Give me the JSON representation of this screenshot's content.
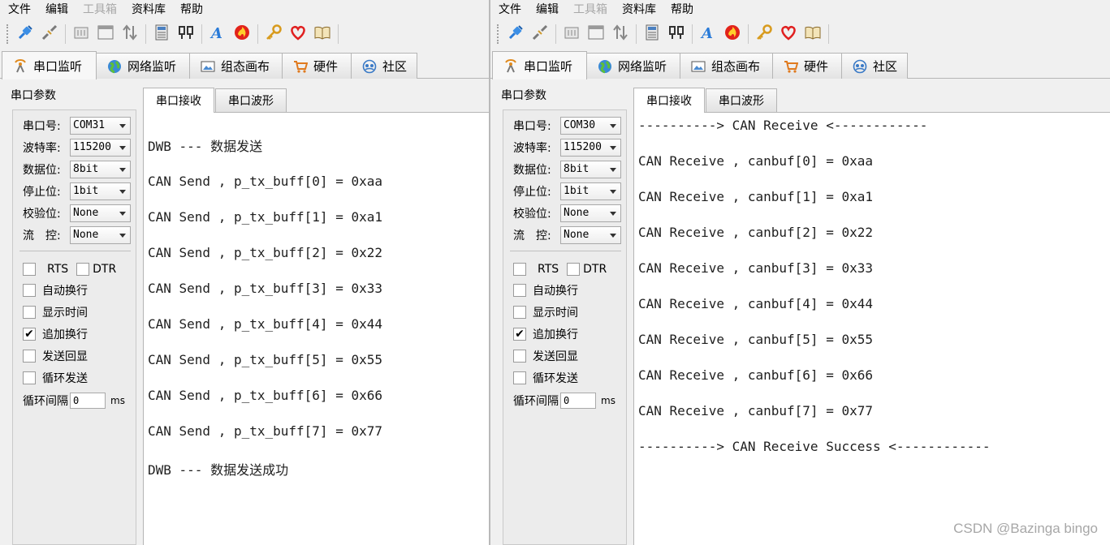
{
  "colors": {
    "accent": "#2a7bd8",
    "window_bg": "#f0f0f0",
    "text": "#1e1e1e",
    "watermark": "#a7a7a7"
  },
  "windows": [
    {
      "menu": [
        "文件",
        "编辑",
        "工具箱",
        "资料库",
        "帮助"
      ],
      "menu_disabled_index": 2,
      "main_tabs": [
        {
          "label": "串口监听",
          "icon": "antenna-icon",
          "active": true
        },
        {
          "label": "网络监听",
          "icon": "globe-icon",
          "active": false
        },
        {
          "label": "组态画布",
          "icon": "canvas-icon",
          "active": false
        },
        {
          "label": "硬件",
          "icon": "cart-icon",
          "active": false
        },
        {
          "label": "社区",
          "icon": "community-icon",
          "active": false
        }
      ],
      "panel_title": "串口参数",
      "settings": [
        {
          "label": "串口号:",
          "value": "COM31"
        },
        {
          "label": "波特率:",
          "value": "115200"
        },
        {
          "label": "数据位:",
          "value": "8bit"
        },
        {
          "label": "停止位:",
          "value": "1bit"
        },
        {
          "label": "校验位:",
          "value": "None"
        },
        {
          "label": "流　控:",
          "value": "None"
        }
      ],
      "rts_label": "RTS",
      "dtr_label": "DTR",
      "options": [
        {
          "label": "自动换行",
          "checked": false
        },
        {
          "label": "显示时间",
          "checked": false
        },
        {
          "label": "追加换行",
          "checked": true
        },
        {
          "label": "发送回显",
          "checked": false
        },
        {
          "label": "循环发送",
          "checked": false
        }
      ],
      "interval_label": "循环间隔",
      "interval_value": "0",
      "interval_unit": "ms",
      "sub_tabs": [
        "串口接收",
        "串口波形"
      ],
      "receive_lines": [
        "DWB --- 数据发送",
        "CAN Send , p_tx_buff[0] = 0xaa",
        "CAN Send , p_tx_buff[1] = 0xa1",
        "CAN Send , p_tx_buff[2] = 0x22",
        "CAN Send , p_tx_buff[3] = 0x33",
        "CAN Send , p_tx_buff[4] = 0x44",
        "CAN Send , p_tx_buff[5] = 0x55",
        "CAN Send , p_tx_buff[6] = 0x66",
        "CAN Send , p_tx_buff[7] = 0x77",
        "DWB --- 数据发送成功"
      ]
    },
    {
      "menu": [
        "文件",
        "编辑",
        "工具箱",
        "资料库",
        "帮助"
      ],
      "menu_disabled_index": 2,
      "main_tabs": [
        {
          "label": "串口监听",
          "icon": "antenna-icon",
          "active": true
        },
        {
          "label": "网络监听",
          "icon": "globe-icon",
          "active": false
        },
        {
          "label": "组态画布",
          "icon": "canvas-icon",
          "active": false
        },
        {
          "label": "硬件",
          "icon": "cart-icon",
          "active": false
        },
        {
          "label": "社区",
          "icon": "community-icon",
          "active": false
        }
      ],
      "panel_title": "串口参数",
      "settings": [
        {
          "label": "串口号:",
          "value": "COM30"
        },
        {
          "label": "波特率:",
          "value": "115200"
        },
        {
          "label": "数据位:",
          "value": "8bit"
        },
        {
          "label": "停止位:",
          "value": "1bit"
        },
        {
          "label": "校验位:",
          "value": "None"
        },
        {
          "label": "流　控:",
          "value": "None"
        }
      ],
      "rts_label": "RTS",
      "dtr_label": "DTR",
      "options": [
        {
          "label": "自动换行",
          "checked": false
        },
        {
          "label": "显示时间",
          "checked": false
        },
        {
          "label": "追加换行",
          "checked": true
        },
        {
          "label": "发送回显",
          "checked": false
        },
        {
          "label": "循环发送",
          "checked": false
        }
      ],
      "interval_label": "循环间隔",
      "interval_value": "0",
      "interval_unit": "ms",
      "sub_tabs": [
        "串口接收",
        "串口波形"
      ],
      "receive_lines": [
        "----------> CAN Receive <------------",
        "CAN Receive , canbuf[0] = 0xaa",
        "CAN Receive , canbuf[1] = 0xa1",
        "CAN Receive , canbuf[2] = 0x22",
        "CAN Receive , canbuf[3] = 0x33",
        "CAN Receive , canbuf[4] = 0x44",
        "CAN Receive , canbuf[5] = 0x55",
        "CAN Receive , canbuf[6] = 0x66",
        "CAN Receive , canbuf[7] = 0x77",
        "----------> CAN Receive Success <------------"
      ]
    }
  ],
  "toolbar_icons": [
    "plug-icon",
    "disconnect-icon",
    "|",
    "panel-icon",
    "window-icon",
    "swap-icon",
    "|",
    "calculator-icon",
    "usb-icon",
    "|",
    "font-icon",
    "flame-icon",
    "|",
    "key-icon",
    "heart-icon",
    "book-icon",
    "|"
  ],
  "watermark": "CSDN @Bazinga bingo"
}
